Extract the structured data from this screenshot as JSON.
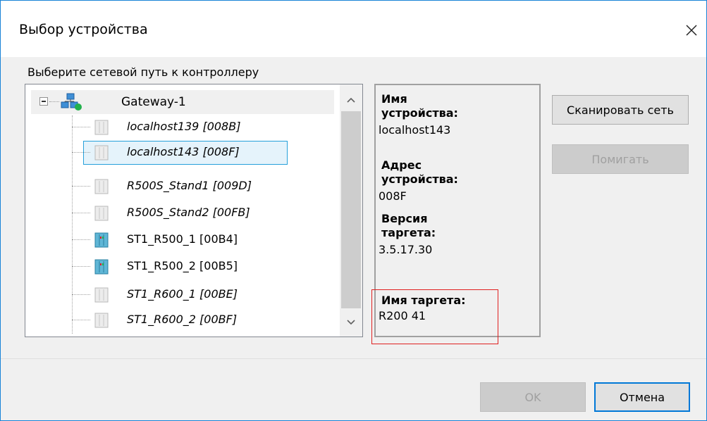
{
  "dialog": {
    "title": "Выбор устройства",
    "section_label": "Выберите сетевой путь к контроллеру"
  },
  "tree": {
    "gateway": "Gateway-1",
    "items": [
      {
        "label": "localhost139 [008B]",
        "italic": true,
        "icon": "device-gray-icon"
      },
      {
        "label": "localhost143 [008F]",
        "italic": true,
        "icon": "device-gray-icon",
        "selected": true
      },
      {
        "label": "R500S_Stand1 [009D]",
        "italic": true,
        "icon": "device-gray-icon"
      },
      {
        "label": "R500S_Stand2 [00FB]",
        "italic": true,
        "icon": "device-gray-icon"
      },
      {
        "label": "ST1_R500_1 [00B4]",
        "italic": false,
        "icon": "device-active-icon"
      },
      {
        "label": "ST1_R500_2 [00B5]",
        "italic": false,
        "icon": "device-active-icon"
      },
      {
        "label": "ST1_R600_1 [00BE]",
        "italic": true,
        "icon": "device-gray-icon"
      },
      {
        "label": "ST1_R600_2 [00BF]",
        "italic": true,
        "icon": "device-gray-icon"
      }
    ]
  },
  "info": {
    "device_name_label_1": "Имя",
    "device_name_label_2": "устройства:",
    "device_name_value": "localhost143",
    "device_addr_label_1": "Адрес",
    "device_addr_label_2": "устройства:",
    "device_addr_value": "008F",
    "target_version_label_1": "Версия",
    "target_version_label_2": "таргета:",
    "target_version_value": "3.5.17.30",
    "target_name_label": "Имя таргета:",
    "target_name_value": "R200 41"
  },
  "buttons": {
    "scan": "Сканировать сеть",
    "blink": "Помигать",
    "ok": "OK",
    "cancel": "Отмена"
  },
  "colors": {
    "accent": "#0078d7",
    "highlight": "#e02020"
  }
}
